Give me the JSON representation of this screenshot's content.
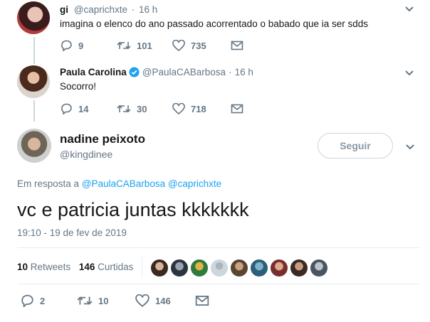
{
  "tweet1": {
    "name": "gi",
    "handle": "@caprichxte",
    "sep": "·",
    "time": "16 h",
    "text": "imagina o elenco do ano passado acorrentado o babado que ia ser sdds",
    "replies": "9",
    "retweets": "101",
    "likes": "735"
  },
  "tweet2": {
    "name": "Paula Carolina",
    "handle": "@PaulaCABarbosa",
    "sep": "·",
    "time": "16 h",
    "text": "Socorro!",
    "replies": "14",
    "retweets": "30",
    "likes": "718"
  },
  "main": {
    "name": "nadine peixoto",
    "handle": "@kingdinee",
    "follow_label": "Seguir",
    "reply_prefix": "Em resposta a",
    "reply_to_1": "@PaulaCABarbosa",
    "reply_to_2": "@caprichxte",
    "text": "vc e patricia juntas kkkkkkk",
    "timestamp": "19:10 - 19 de fev de 2019",
    "retweet_count": "10",
    "retweet_label": "Retweets",
    "like_count": "146",
    "like_label": "Curtidas",
    "replies": "2",
    "retweets": "10",
    "likes": "146"
  },
  "colors": {
    "link": "#1da1f2",
    "muted": "#657786",
    "text": "#14171a",
    "verified": "#1da1f2"
  },
  "icons": [
    "reply-icon",
    "retweet-icon",
    "like-icon",
    "dm-icon",
    "chevron-down-icon",
    "verified-badge-icon"
  ]
}
